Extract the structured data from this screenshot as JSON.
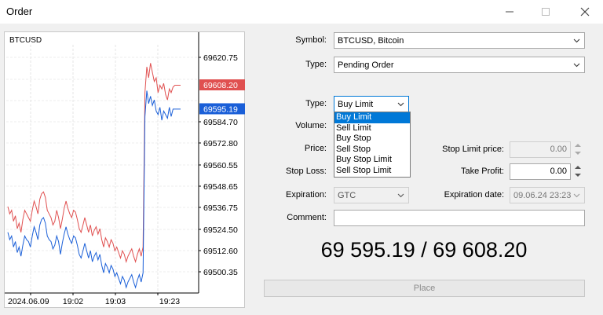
{
  "window": {
    "title": "Order",
    "minimize_icon": "minimize-icon",
    "maximize_icon": "maximize-icon",
    "close_icon": "close-icon"
  },
  "chart": {
    "symbol": "BTCUSD",
    "price_ticks": [
      "69620.75",
      "69608.20",
      "69595.19",
      "69584.70",
      "69572.80",
      "69560.55",
      "69548.65",
      "69536.75",
      "69524.50",
      "69512.60",
      "69500.35"
    ],
    "ask_label": "69608.20",
    "bid_label": "69595.19",
    "time_ticks": [
      "2024.06.09",
      "19:02",
      "19:03",
      "19:23"
    ],
    "ask_color": "#e05050",
    "bid_color": "#1a5fd8",
    "ask_series": [
      69542,
      69538,
      69540,
      69534,
      69537,
      69530,
      69533,
      69528,
      69535,
      69540,
      69538,
      69536,
      69534,
      69540,
      69545,
      69542,
      69538,
      69546,
      69549,
      69550,
      69547,
      69540,
      69538,
      69536,
      69532,
      69534,
      69540,
      69536,
      69530,
      69535,
      69541,
      69545,
      69541,
      69538,
      69536,
      69540,
      69539,
      69535,
      69530,
      69528,
      69532,
      69536,
      69532,
      69528,
      69532,
      69526,
      69529,
      69531,
      69527,
      69530,
      69524,
      69520,
      69525,
      69523,
      69520,
      69524,
      69522,
      69518,
      69520,
      69517,
      69514,
      69518,
      69516,
      69512,
      69515,
      69517,
      69519,
      69515,
      69512,
      69516,
      69519,
      69515,
      69520,
      69604,
      69618,
      69612,
      69620,
      69615,
      69610,
      69612,
      69604,
      69608,
      69606,
      69609,
      69603,
      69600,
      69606,
      69604,
      69607,
      69608,
      69608,
      69608,
      69608
    ],
    "bid_series": [
      69528,
      69524,
      69526,
      69520,
      69523,
      69517,
      69520,
      69515,
      69521,
      69526,
      69524,
      69523,
      69520,
      69526,
      69531,
      69528,
      69524,
      69532,
      69535,
      69536,
      69533,
      69526,
      69524,
      69523,
      69519,
      69521,
      69526,
      69523,
      69516,
      69522,
      69527,
      69531,
      69527,
      69524,
      69522,
      69526,
      69525,
      69521,
      69516,
      69514,
      69518,
      69522,
      69518,
      69514,
      69518,
      69512,
      69515,
      69517,
      69513,
      69516,
      69510,
      69506,
      69511,
      69509,
      69506,
      69510,
      69508,
      69504,
      69506,
      69503,
      69500,
      69504,
      69502,
      69498,
      69501,
      69503,
      69505,
      69501,
      69498,
      69502,
      69505,
      69501,
      69506,
      69591,
      69605,
      69598,
      69602,
      69597,
      69600,
      69594,
      69592,
      69596,
      69589,
      69594,
      69592,
      69590,
      69596,
      69591,
      69595,
      69595,
      69595,
      69595,
      69595
    ]
  },
  "form": {
    "symbol_label": "Symbol:",
    "symbol_value": "BTCUSD, Bitcoin",
    "type_label": "Type:",
    "type_value": "Pending Order",
    "order_type_label": "Type:",
    "order_type_value": "Buy Limit",
    "order_type_options": [
      "Buy Limit",
      "Sell Limit",
      "Buy Stop",
      "Sell Stop",
      "Buy Stop Limit",
      "Sell Stop Limit"
    ],
    "volume_label": "Volume:",
    "price_label": "Price:",
    "stop_limit_label": "Stop Limit price:",
    "stop_limit_value": "0.00",
    "stop_loss_label": "Stop Loss:",
    "take_profit_label": "Take Profit:",
    "take_profit_value": "0.00",
    "expiration_label": "Expiration:",
    "expiration_value": "GTC",
    "expiration_date_label": "Expiration date:",
    "expiration_date_value": "09.06.24 23:23",
    "comment_label": "Comment:",
    "comment_value": ""
  },
  "quote": {
    "bid": "69 595.19",
    "separator": "/",
    "ask": "69 608.20"
  },
  "place_button": "Place"
}
